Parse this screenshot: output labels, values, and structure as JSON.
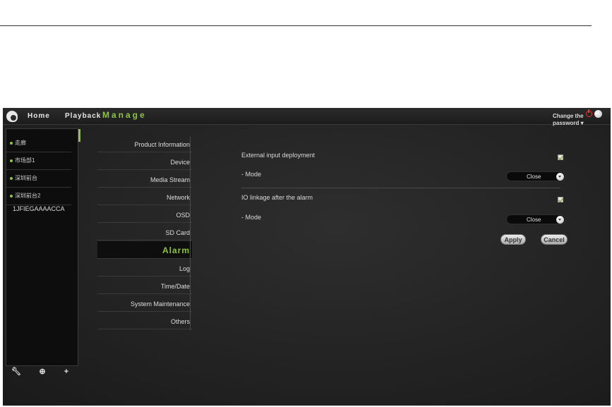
{
  "topbar": {
    "nav": [
      "Home",
      "Playback",
      "Manage"
    ],
    "change_password": "Change the password ▾"
  },
  "devices": {
    "items": [
      "走廊",
      "市场部1",
      "深圳前台",
      "深圳前台2"
    ],
    "plain_item": "1JFIEGAAAACCA"
  },
  "menu": {
    "items": [
      "Product Information",
      "Device",
      "Media Stream",
      "Network",
      "OSD",
      "SD Card",
      "Alarm",
      "Log",
      "Time/Date",
      "System Maintenance",
      "Others"
    ],
    "active": "Alarm"
  },
  "alarm": {
    "external_input_label": "External input deployment",
    "mode_label_1": "- Mode",
    "mode_value_1": "Close",
    "io_linkage_label": "IO linkage after the alarm",
    "mode_label_2": "- Mode",
    "mode_value_2": "Close",
    "apply_label": "Apply",
    "cancel_label": "Cancel"
  },
  "colors": {
    "accent": "#8cc63f",
    "background": "#232323",
    "panel": "#0d0d0d"
  }
}
